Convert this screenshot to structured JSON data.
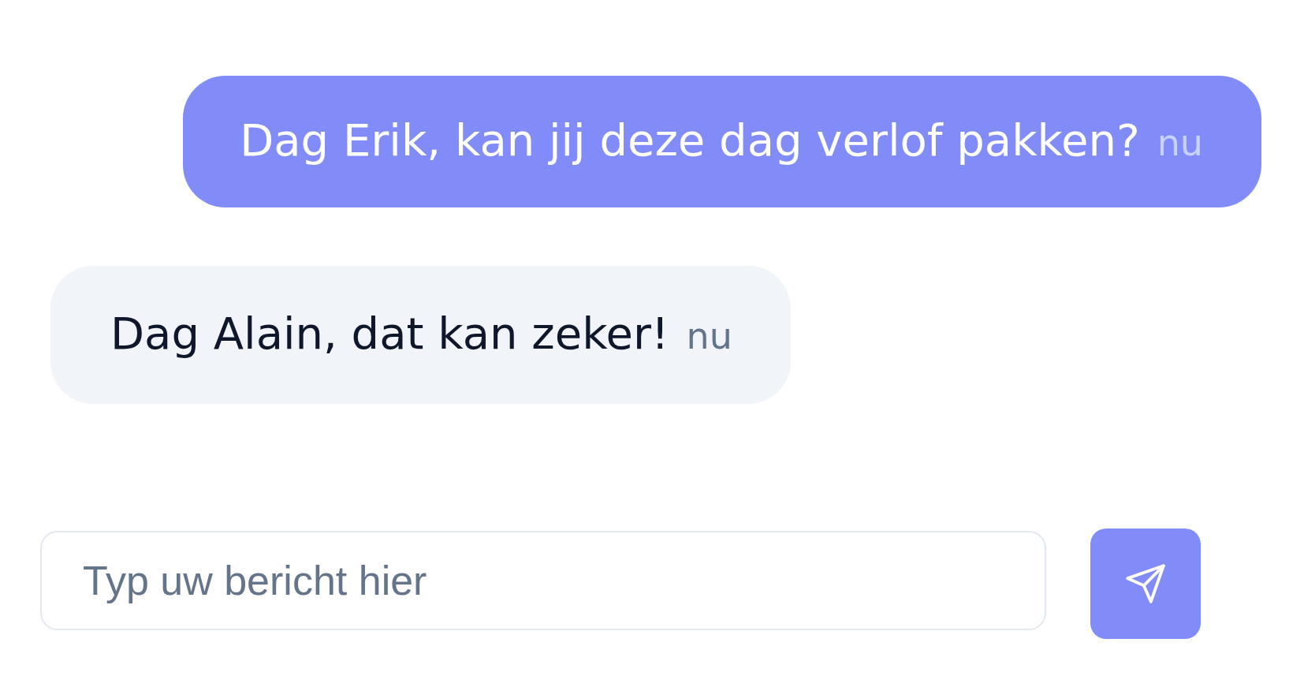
{
  "messages": [
    {
      "kind": "sent",
      "text": "Dag Erik, kan jij deze dag verlof pakken?",
      "time": "nu"
    },
    {
      "kind": "received",
      "text": "Dag Alain, dat kan zeker!",
      "time": "nu"
    }
  ],
  "composer": {
    "placeholder": "Typ uw bericht hier"
  }
}
